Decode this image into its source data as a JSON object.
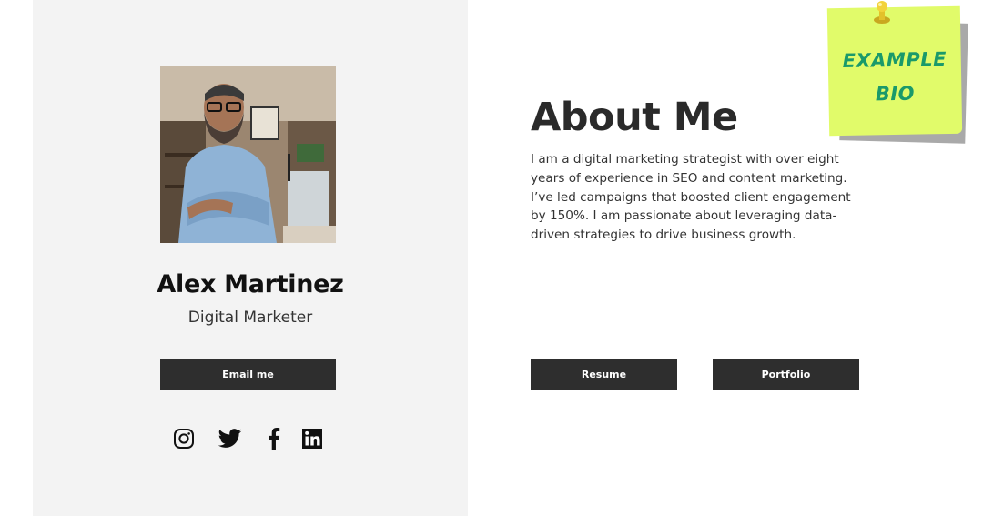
{
  "profile": {
    "name": "Alex Martinez",
    "role": "Digital Marketer",
    "email_button": "Email me",
    "photo_alt": "Portrait photo"
  },
  "social": [
    {
      "icon": "instagram-icon"
    },
    {
      "icon": "twitter-icon"
    },
    {
      "icon": "facebook-icon"
    },
    {
      "icon": "linkedin-icon"
    }
  ],
  "about": {
    "title": "About Me",
    "text": "I am a digital marketing strategist with over eight years of experience in SEO and content marketing. I’ve led campaigns that boosted client engagement by 150%. I am passionate about leveraging data-driven strategies to drive business growth.",
    "resume_button": "Resume",
    "portfolio_button": "Portfolio"
  },
  "sticky_note": {
    "line1": "EXAMPLE",
    "line2": "BIO"
  },
  "colors": {
    "left_panel": "#f3f3f3",
    "button_bg": "#2e2e2e",
    "sticky_bg": "#e1fb6a",
    "sticky_text": "#1a9a6a"
  }
}
